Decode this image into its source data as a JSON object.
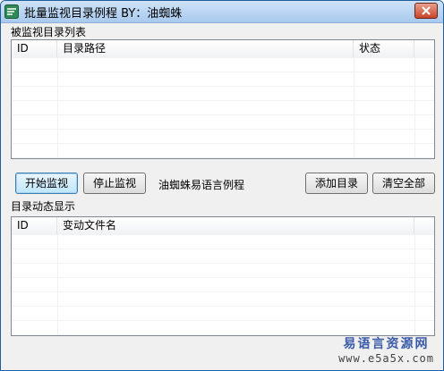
{
  "window": {
    "title": "批量监视目录例程  BY：油蜘蛛"
  },
  "top_list": {
    "label": "被监视目录列表",
    "columns": [
      "ID",
      "目录路径",
      "状态"
    ],
    "rows": []
  },
  "buttons": {
    "start": "开始监视",
    "stop": "停止监视",
    "add_dir": "添加目录",
    "clear_all": "清空全部"
  },
  "caption": "油蜘蛛易语言例程",
  "bottom_list": {
    "label": "目录动态显示",
    "columns": [
      "ID",
      "变动文件名"
    ],
    "rows": []
  },
  "watermark": {
    "line1": "易语言资源网",
    "line2": "www.e5a5x.com"
  }
}
